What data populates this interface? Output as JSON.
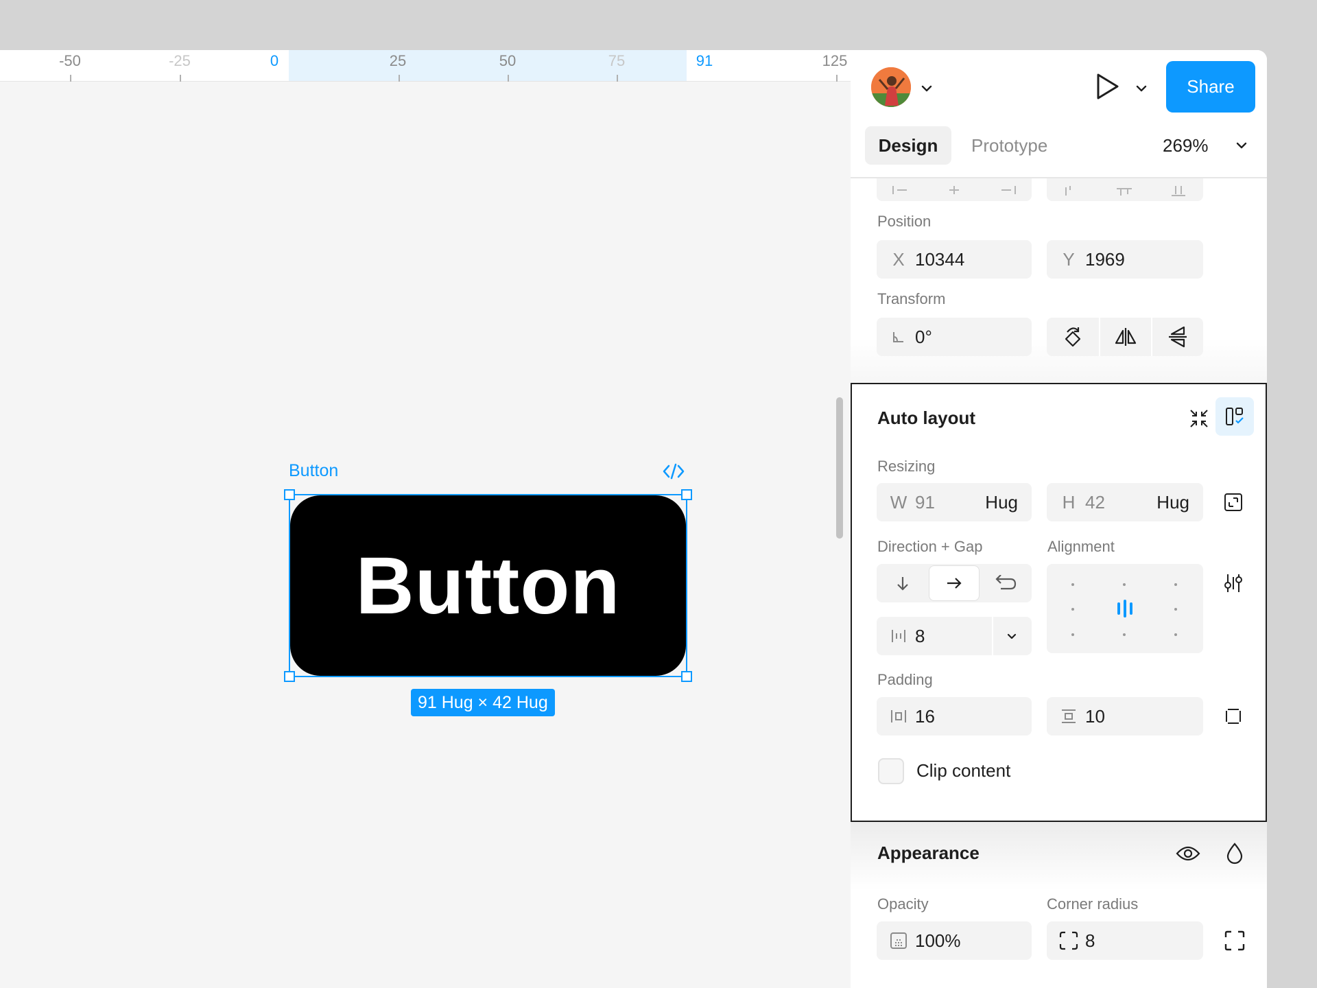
{
  "ruler": {
    "ticks": [
      "-50",
      "-25",
      "0",
      "25",
      "50",
      "75",
      "91",
      "125"
    ]
  },
  "canvas": {
    "frame_label": "Button",
    "button_text": "Button",
    "size_badge": "91 Hug × 42 Hug"
  },
  "header": {
    "share_label": "Share",
    "tabs": {
      "design": "Design",
      "prototype": "Prototype"
    },
    "zoom": "269%"
  },
  "position": {
    "label": "Position",
    "x_prefix": "X",
    "x_value": "10344",
    "y_prefix": "Y",
    "y_value": "1969"
  },
  "transform": {
    "label": "Transform",
    "rotation": "0°"
  },
  "auto_layout": {
    "title": "Auto layout",
    "resizing_label": "Resizing",
    "w_prefix": "W",
    "w_value": "91",
    "w_mode": "Hug",
    "h_prefix": "H",
    "h_value": "42",
    "h_mode": "Hug",
    "direction_label": "Direction + Gap",
    "alignment_label": "Alignment",
    "gap_value": "8",
    "padding_label": "Padding",
    "padding_h": "16",
    "padding_v": "10",
    "clip_label": "Clip content"
  },
  "appearance": {
    "title": "Appearance",
    "opacity_label": "Opacity",
    "opacity_value": "100%",
    "radius_label": "Corner radius",
    "radius_value": "8"
  },
  "colors": {
    "accent": "#0d99ff",
    "canvas_bg": "#f5f5f5",
    "panel_bg": "#ffffff"
  }
}
